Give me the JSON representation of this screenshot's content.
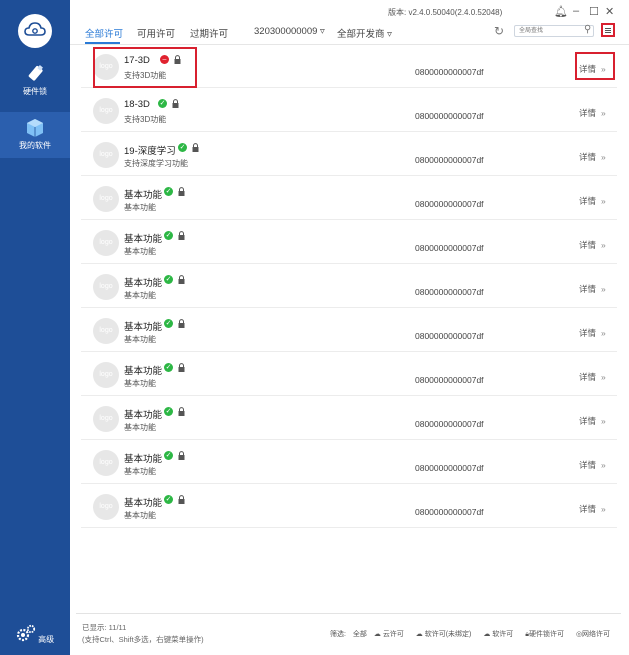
{
  "window": {
    "version": "版本: v2.4.0.50040(2.4.0.52048)"
  },
  "sidebar": {
    "items": [
      {
        "label": "硬件锁"
      },
      {
        "label": "我的软件"
      }
    ],
    "bottom_label": "高级"
  },
  "tabs": [
    {
      "label": "全部许可"
    },
    {
      "label": "可用许可"
    },
    {
      "label": "过期许可"
    },
    {
      "label": "320300000009 ▿"
    },
    {
      "label": "全部开发商 ▿"
    }
  ],
  "search": {
    "placeholder": "全局查找"
  },
  "rows": [
    {
      "avatar": "logo",
      "name": "17-3D",
      "desc": "支持3D功能",
      "code": "0800000000007df",
      "detail": "详情",
      "status": "error"
    },
    {
      "avatar": "logo",
      "name": "18-3D",
      "desc": "支持3D功能",
      "code": "0800000000007df",
      "detail": "详情",
      "status": "ok"
    },
    {
      "avatar": "logo",
      "name": "19-深度学习",
      "desc": "支持深度学习功能",
      "code": "0800000000007df",
      "detail": "详情",
      "status": "ok"
    },
    {
      "avatar": "logo",
      "name": "基本功能",
      "desc": "基本功能",
      "code": "0800000000007df",
      "detail": "详情",
      "status": "ok"
    },
    {
      "avatar": "logo",
      "name": "基本功能",
      "desc": "基本功能",
      "code": "0800000000007df",
      "detail": "详情",
      "status": "ok"
    },
    {
      "avatar": "logo",
      "name": "基本功能",
      "desc": "基本功能",
      "code": "0800000000007df",
      "detail": "详情",
      "status": "ok"
    },
    {
      "avatar": "logo",
      "name": "基本功能",
      "desc": "基本功能",
      "code": "0800000000007df",
      "detail": "详情",
      "status": "ok"
    },
    {
      "avatar": "logo",
      "name": "基本功能",
      "desc": "基本功能",
      "code": "0800000000007df",
      "detail": "详情",
      "status": "ok"
    },
    {
      "avatar": "logo",
      "name": "基本功能",
      "desc": "基本功能",
      "code": "0800000000007df",
      "detail": "详情",
      "status": "ok"
    },
    {
      "avatar": "logo",
      "name": "基本功能",
      "desc": "基本功能",
      "code": "0800000000007df",
      "detail": "详情",
      "status": "ok"
    },
    {
      "avatar": "logo",
      "name": "基本功能",
      "desc": "基本功能",
      "code": "0800000000007df",
      "detail": "详情",
      "status": "ok"
    }
  ],
  "footer": {
    "shown": "已显示:  11/11",
    "hint": "(支持Ctrl、Shift多选，右键菜单操作)",
    "filter_label": "筛选:",
    "filters": [
      "全部",
      "云许可",
      "软许可(未绑定)",
      "软许可",
      "硬件锁许可",
      "网络许可"
    ]
  },
  "colors": {
    "sidebar": "#1e4e97",
    "accent": "#2a7ad6",
    "highlight": "#d8202f",
    "ok": "#2db745",
    "error": "#e0222f"
  }
}
